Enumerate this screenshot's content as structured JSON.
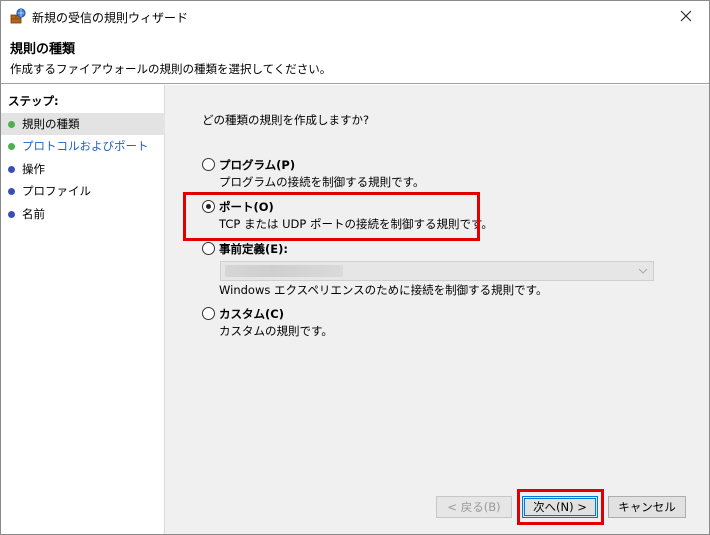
{
  "window": {
    "title": "新規の受信の規則ウィザード",
    "icon": "firewall-shield-icon"
  },
  "header": {
    "title": "規則の種類",
    "description": "作成するファイアウォールの規則の種類を選択してください。"
  },
  "sidebar": {
    "steps_title": "ステップ:",
    "steps": [
      {
        "label": "規則の種類",
        "state": "current",
        "dot_color": "#4caf50"
      },
      {
        "label": "プロトコルおよびポート",
        "state": "link",
        "dot_color": "#4caf50"
      },
      {
        "label": "操作",
        "state": "pending",
        "dot_color": "#3a4fb5"
      },
      {
        "label": "プロファイル",
        "state": "pending",
        "dot_color": "#3a4fb5"
      },
      {
        "label": "名前",
        "state": "pending",
        "dot_color": "#3a4fb5"
      }
    ]
  },
  "main": {
    "question": "どの種類の規則を作成しますか?",
    "options": [
      {
        "label": "プログラム(P)",
        "description": "プログラムの接続を制御する規則です。",
        "checked": false
      },
      {
        "label": "ポート(O)",
        "description": "TCP または UDP ポートの接続を制御する規則です。",
        "checked": true
      },
      {
        "label": "事前定義(E):",
        "description": "Windows エクスペリエンスのために接続を制御する規則です。",
        "checked": false
      },
      {
        "label": "カスタム(C)",
        "description": "カスタムの規則です。",
        "checked": false
      }
    ],
    "predefined_select_value": ""
  },
  "buttons": {
    "back": "< 戻る(B)",
    "next": "次へ(N) >",
    "cancel": "キャンセル"
  },
  "colors": {
    "highlight": "#e00000",
    "link": "#1e63c7",
    "primary_border": "#0078d7"
  }
}
